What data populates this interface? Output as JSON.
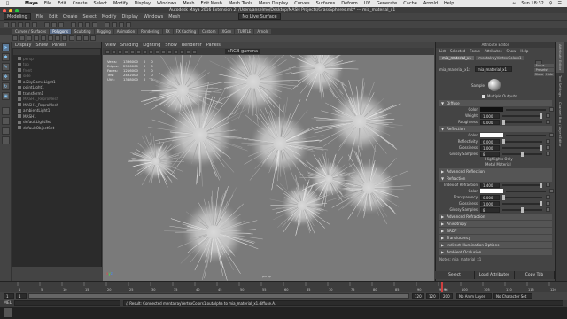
{
  "mac": {
    "app_name": "Maya",
    "menus": [
      "File",
      "Edit",
      "Create",
      "Select",
      "Modify",
      "Display",
      "Windows",
      "Mesh",
      "Edit Mesh",
      "Mesh Tools",
      "Mesh Display",
      "Curves",
      "Surfaces",
      "Deform",
      "UV",
      "Generate",
      "Cache",
      "Arnold",
      "Help"
    ],
    "clock": "Sun 18:32"
  },
  "window": {
    "title": "Autodesk Maya 2016 Extension 2: /Users/anselmo/Desktop/MASH Projects/GrassSpheres.mb* --- mia_material_x1"
  },
  "maya_menu": {
    "mode": "Modeling",
    "live_surface": "No Live Surface",
    "items": [
      "File",
      "Edit",
      "Create",
      "Select",
      "Modify",
      "Display",
      "Windows",
      "Mesh",
      "Edit Mesh",
      "Mesh Tools",
      "Mesh Display",
      "Curves",
      "Surfaces",
      "Deform",
      "UV",
      "Generate",
      "Cache",
      "Arnold",
      "Help"
    ]
  },
  "shelf_tabs": [
    "Curves / Surfaces",
    "Polygons",
    "Sculpting",
    "Rigging",
    "Animation",
    "Rendering",
    "FX",
    "FX Caching",
    "Custom",
    "XGen",
    "TURTLE",
    "Arnold"
  ],
  "shelf_active": "Polygons",
  "outliner": {
    "menu": [
      "Display",
      "Show",
      "Panels"
    ],
    "items": [
      {
        "label": "persp",
        "dim": true
      },
      {
        "label": "top",
        "dim": true
      },
      {
        "label": "front",
        "dim": true
      },
      {
        "label": "side",
        "dim": true
      },
      {
        "label": "aiSkyDomeLight1",
        "dim": false
      },
      {
        "label": "pointLight1",
        "dim": false
      },
      {
        "label": "transform1",
        "dim": false
      },
      {
        "label": "MASH1_ReproMesh",
        "dim": true
      },
      {
        "label": "MASH1_ReproMesh",
        "dim": false
      },
      {
        "label": "ambientLight1",
        "dim": false
      },
      {
        "label": "MASH1",
        "dim": false
      },
      {
        "label": "defaultLightSet",
        "dim": false
      },
      {
        "label": "defaultObjectSet",
        "dim": false
      }
    ]
  },
  "viewport": {
    "menu": [
      "View",
      "Shading",
      "Lighting",
      "Show",
      "Renderer",
      "Panels"
    ],
    "color_space": "sRGB gamma",
    "hud": [
      {
        "label": "Verts:",
        "a": "1336000",
        "b": "0",
        "c": "0"
      },
      {
        "label": "Edges:",
        "a": "2536000",
        "b": "0",
        "c": "0"
      },
      {
        "label": "Faces:",
        "a": "1216000",
        "b": "0",
        "c": "0"
      },
      {
        "label": "Tris:",
        "a": "2432000",
        "b": "0",
        "c": "0"
      },
      {
        "label": "UVs:",
        "a": "1368000",
        "b": "0",
        "c": "0"
      }
    ],
    "camera": "persp"
  },
  "attribute_editor": {
    "header": "Attribute Editor",
    "menus": [
      "List",
      "Selected",
      "Focus",
      "Attributes",
      "Show",
      "Help"
    ],
    "tabs": [
      "mia_material_x1",
      "mentalrayVertexColors1"
    ],
    "type_label": "mia_material_x1:",
    "node_name": "mia_material_x1",
    "buttons": [
      "Focus",
      "Presets*",
      "Show",
      "Hide"
    ],
    "sample_label": "Sample",
    "multiple_outputs": "Multiple Outputs",
    "sections": {
      "diffuse": "Diffuse",
      "reflection": "Reflection",
      "adv_reflection": "Advanced Reflection",
      "refraction": "Refraction",
      "adv_refraction": "Advanced Refraction",
      "anisotropy": "Anisotropy",
      "brdf": "BRDF",
      "translucency": "Translucency",
      "indirect": "Indirect Illumination Options",
      "ao": "Ambient Occlusion"
    },
    "diffuse_rows": [
      {
        "label": "Color",
        "value": ""
      },
      {
        "label": "Weight",
        "value": "1.000"
      },
      {
        "label": "Roughness",
        "value": "0.000"
      }
    ],
    "reflection_rows": [
      {
        "label": "Color",
        "value": ""
      },
      {
        "label": "Reflectivity",
        "value": "0.000"
      },
      {
        "label": "Glossiness",
        "value": "1.000"
      },
      {
        "label": "Glossy Samples",
        "value": "8"
      }
    ],
    "highlights_only": "Highlights Only",
    "metal_material": "Metal Material",
    "refraction_rows": [
      {
        "label": "Index of Refraction",
        "value": "1.400"
      },
      {
        "label": "Color",
        "value": ""
      },
      {
        "label": "Transparency",
        "value": "0.000"
      },
      {
        "label": "Glossiness",
        "value": "1.000"
      },
      {
        "label": "Glossy Samples",
        "value": "8"
      }
    ],
    "notes_label": "Notes: mia_material_x1",
    "select_buttons": [
      "Select",
      "Load Attributes",
      "Copy Tab"
    ]
  },
  "channel_tabs": [
    "Attribute Editor",
    "Tool Settings",
    "Channel Box / Layer Editor"
  ],
  "time": {
    "ticks": [
      "1",
      "5",
      "10",
      "15",
      "20",
      "25",
      "30",
      "35",
      "40",
      "45",
      "50",
      "55",
      "60",
      "65",
      "70",
      "75",
      "80",
      "85",
      "90",
      "95",
      "100",
      "105",
      "110",
      "115",
      "120"
    ],
    "start": "1",
    "range_start": "1",
    "range_end": "120",
    "end": "120",
    "end2": "200",
    "current_frame": "96",
    "anim_layer": "No Anim Layer",
    "char_set": "No Character Set"
  },
  "command": {
    "lang": "MEL",
    "result": "// Result: Connected mentalrayVertexColors1.outAlpha to mia_material_x1.diffuse.A."
  },
  "colors": {
    "accent": "#5c7a99",
    "viewport_bg": "#7a7a7a",
    "current_frame": "#d04040"
  }
}
